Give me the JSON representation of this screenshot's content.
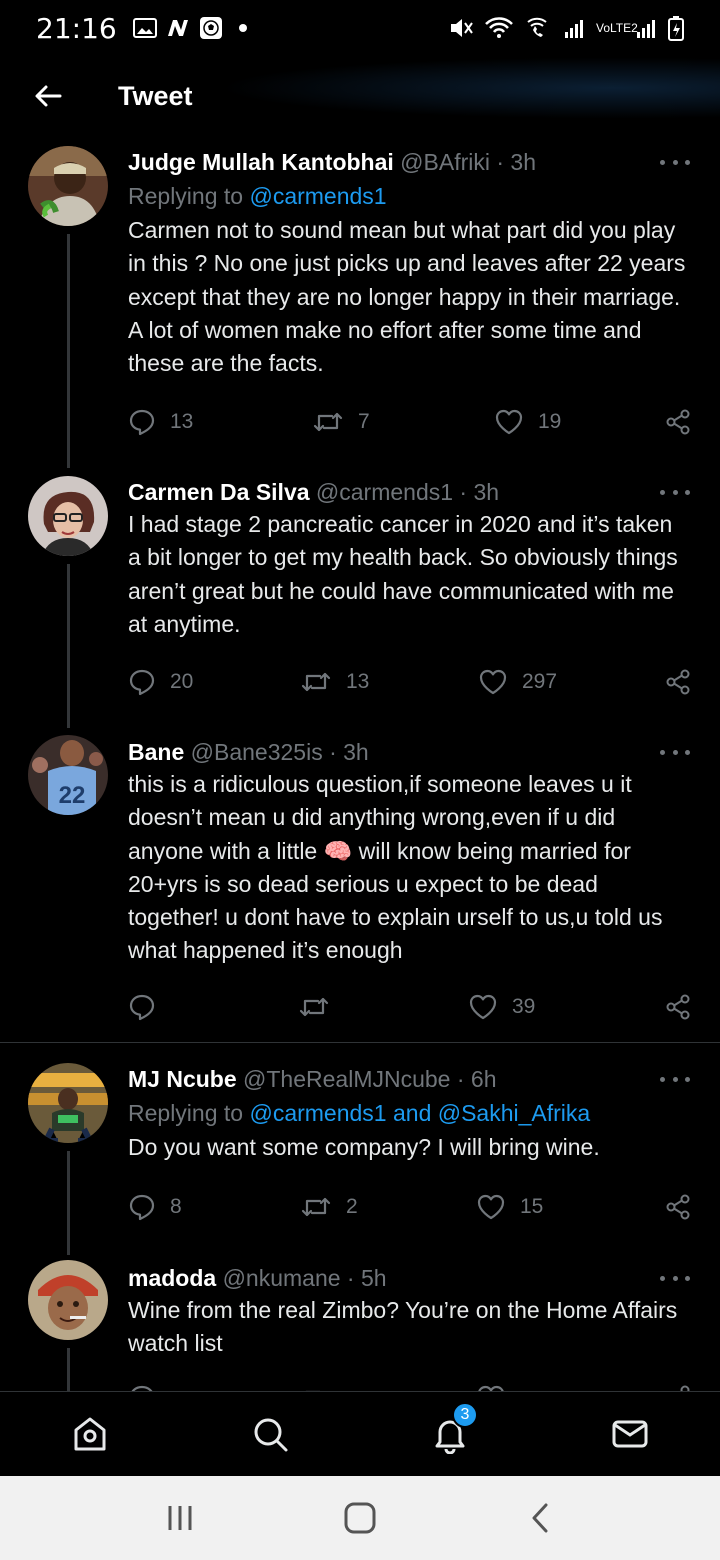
{
  "status_bar": {
    "time": "21:16",
    "left_icons": [
      "gallery-icon",
      "n-app-icon",
      "soccer-ball-icon",
      "dot-icon"
    ],
    "network_label": "VoLTE2"
  },
  "header": {
    "title": "Tweet"
  },
  "tweets": [
    {
      "name": "Judge Mullah Kantobhai",
      "handle": "@BAfriki · 3h",
      "replying_prefix": "Replying to ",
      "replying_to": "@carmends1",
      "text": "Carmen not to sound mean but what part did you play in this ? No one just picks up and leaves after 22 years except that they are no longer happy in their marriage. A lot of women make no effort after some time and these are the facts.",
      "replies": "13",
      "retweets": "7",
      "likes": "19"
    },
    {
      "name": "Carmen Da Silva",
      "handle": "@carmends1 · 3h",
      "text": "I had stage 2 pancreatic cancer in 2020 and it’s taken a bit longer to get my health back. So obviously things aren’t great but he could have communicated with me at anytime.",
      "replies": "20",
      "retweets": "13",
      "likes": "297"
    },
    {
      "name": "Bane",
      "handle": "@Bane325is · 3h",
      "text": "this is a ridiculous question,if someone leaves u it doesn’t mean u did anything wrong,even if u did anyone with a little 🧠 will know being married for 20+yrs is so dead serious u expect to be dead together! u dont have to explain urself to us,u told us what happened it’s enough",
      "replies": "",
      "retweets": "",
      "likes": "39"
    },
    {
      "name": "MJ Ncube",
      "handle": "@TheRealMJNcube · 6h",
      "replying_prefix": "Replying to ",
      "replying_to": "@carmends1 and @Sakhi_Afrika",
      "text": "Do you want some company? I will bring wine.",
      "replies": "8",
      "retweets": "2",
      "likes": "15"
    },
    {
      "name": "madoda",
      "handle": "@nkumane · 5h",
      "text": "Wine from the real Zimbo? You’re on the Home Affairs watch list"
    }
  ],
  "bottom_nav": {
    "items": [
      "home-icon",
      "search-icon",
      "notifications-icon",
      "messages-icon"
    ],
    "notifications_badge": "3"
  },
  "colors": {
    "background": "#000000",
    "accent": "#1d9bf0",
    "muted": "#71767b",
    "text": "#e7e9ea"
  }
}
